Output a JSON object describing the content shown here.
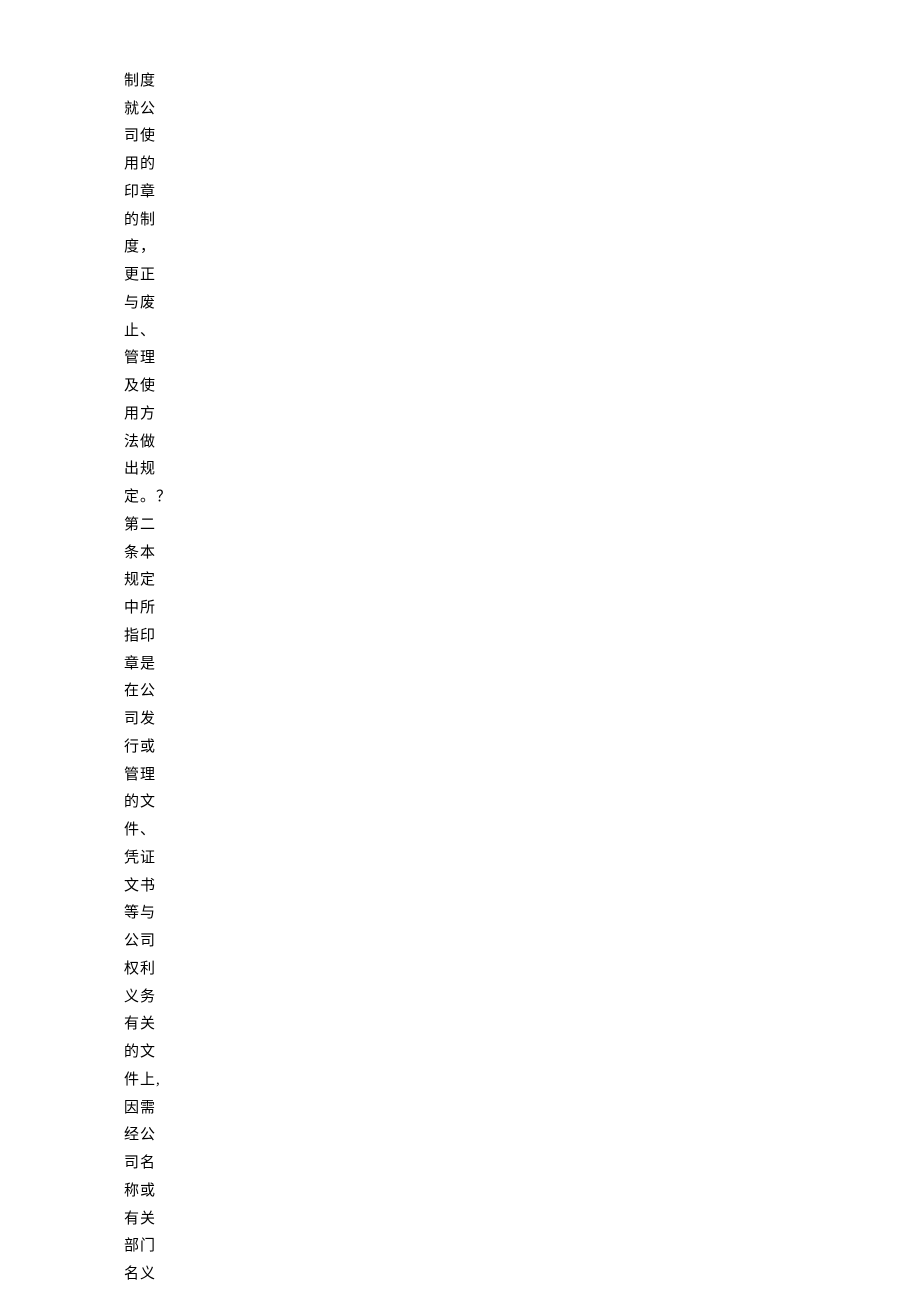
{
  "content": {
    "lines": [
      "制度",
      "就公",
      "司使",
      "用的",
      "印章",
      "的制",
      "度，",
      "更正",
      "与废",
      "止、",
      "管理",
      "及使",
      "用方",
      "法做",
      "出规",
      "定。？",
      "第二",
      "条本",
      "规定",
      "中所",
      "指印",
      "章是",
      "在公",
      "司发",
      "行或",
      "管理",
      "的文",
      "件、",
      "凭证",
      "文书",
      "等与",
      "公司",
      "权利",
      "义务",
      "有关",
      "的文",
      "件上,",
      "因需",
      "经公",
      "司名",
      "称或",
      "有关",
      "部门",
      "名义"
    ]
  }
}
